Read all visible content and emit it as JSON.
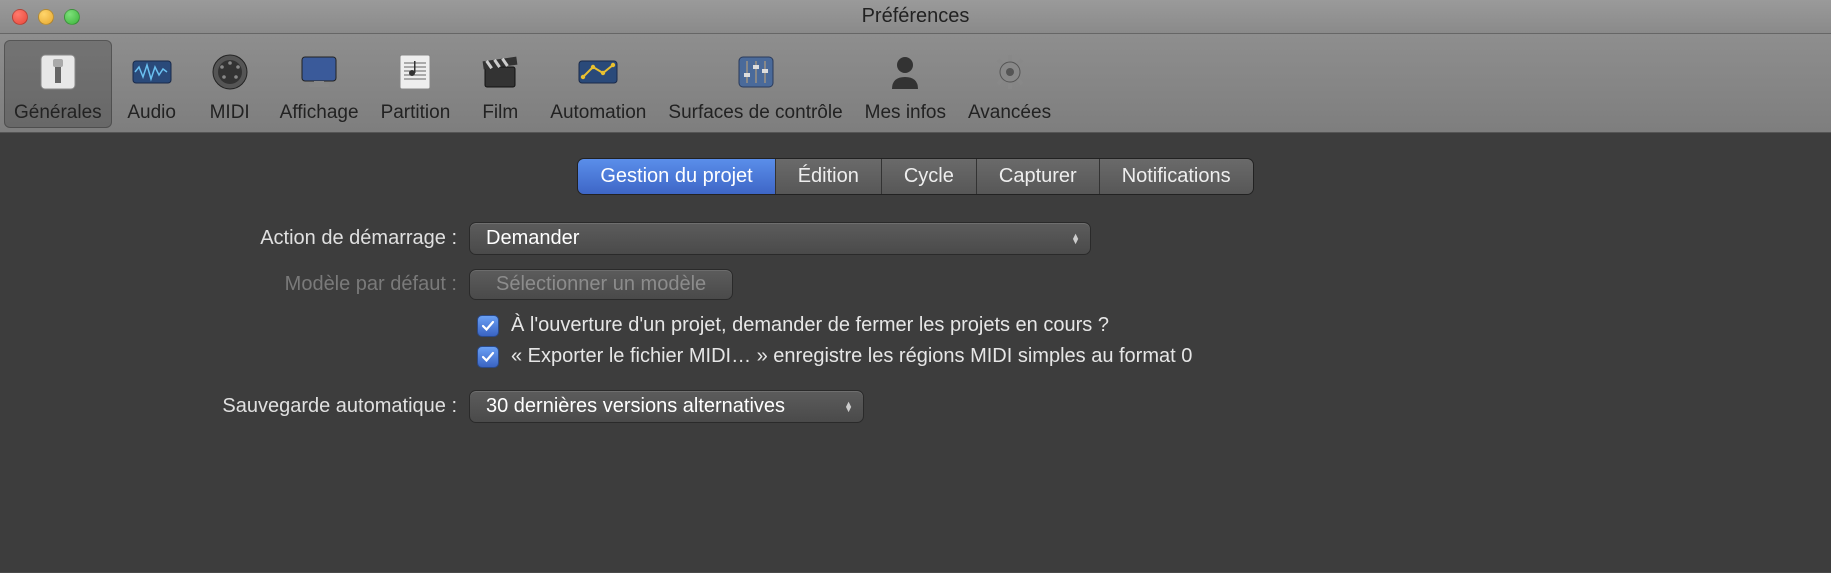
{
  "window": {
    "title": "Préférences"
  },
  "toolbar": {
    "items": [
      {
        "label": "Générales",
        "icon": "switch-icon",
        "selected": true
      },
      {
        "label": "Audio",
        "icon": "waveform-icon",
        "selected": false
      },
      {
        "label": "MIDI",
        "icon": "midi-port-icon",
        "selected": false
      },
      {
        "label": "Affichage",
        "icon": "monitor-icon",
        "selected": false
      },
      {
        "label": "Partition",
        "icon": "score-icon",
        "selected": false
      },
      {
        "label": "Film",
        "icon": "clapboard-icon",
        "selected": false
      },
      {
        "label": "Automation",
        "icon": "automation-icon",
        "selected": false
      },
      {
        "label": "Surfaces de contrôle",
        "icon": "faders-icon",
        "selected": false
      },
      {
        "label": "Mes infos",
        "icon": "person-icon",
        "selected": false
      },
      {
        "label": "Avancées",
        "icon": "gear-icon",
        "selected": false
      }
    ]
  },
  "tabs": {
    "items": [
      {
        "label": "Gestion du projet",
        "active": true
      },
      {
        "label": "Édition",
        "active": false
      },
      {
        "label": "Cycle",
        "active": false
      },
      {
        "label": "Capturer",
        "active": false
      },
      {
        "label": "Notifications",
        "active": false
      }
    ]
  },
  "form": {
    "startup_label": "Action de démarrage :",
    "startup_value": "Demander",
    "template_label": "Modèle par défaut :",
    "template_button": "Sélectionner un modèle",
    "check1": "À l'ouverture d'un projet, demander de fermer les projets en cours ?",
    "check2": "« Exporter le fichier MIDI… » enregistre les régions MIDI simples au format 0",
    "autosave_label": "Sauvegarde automatique :",
    "autosave_value": "30 dernières versions alternatives"
  }
}
